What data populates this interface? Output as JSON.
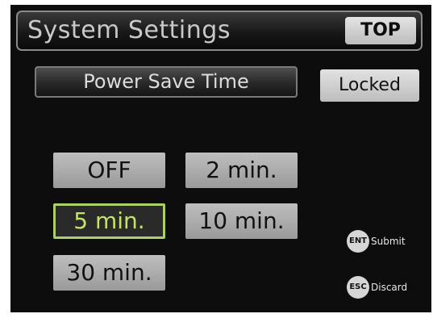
{
  "header": {
    "title": "System Settings",
    "top_button_label": "TOP"
  },
  "section": {
    "title": "Power Save Time",
    "status_badge": "Locked"
  },
  "options": {
    "items": [
      {
        "label": "OFF",
        "selected": false
      },
      {
        "label": "2 min.",
        "selected": false
      },
      {
        "label": "5 min.",
        "selected": true
      },
      {
        "label": "10 min.",
        "selected": false
      },
      {
        "label": "30 min.",
        "selected": false
      }
    ]
  },
  "key_hints": {
    "submit": {
      "key": "ENT",
      "label": "Submit"
    },
    "discard": {
      "key": "ESC",
      "label": "Discard"
    }
  },
  "colors": {
    "background": "#0d0d0d",
    "button": "#b0b0b0",
    "selected_border": "#a9d06a",
    "selected_text": "#c4e36a"
  }
}
